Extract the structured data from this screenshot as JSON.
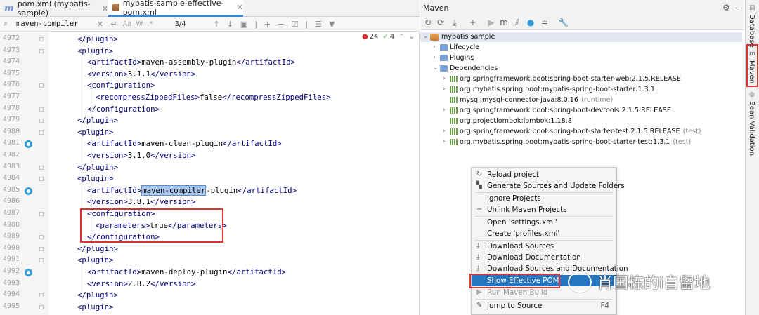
{
  "editor": {
    "tabs": [
      {
        "label": "pom.xml (mybatis-sample)"
      },
      {
        "label": "mybatis-sample-effective-pom.xml"
      }
    ],
    "find": {
      "query": "maven-compiler",
      "case_label": "Aa",
      "word_label": "W",
      "regex_label": ".*",
      "match_count": "3/4"
    },
    "inspections": {
      "warnings": "24",
      "ok": "4"
    },
    "lines": [
      {
        "num": "4972",
        "parts": [
          {
            "t": "tg",
            "v": "</plugin>"
          }
        ]
      },
      {
        "num": "4973",
        "parts": [
          {
            "t": "tg",
            "v": "<plugin>"
          }
        ]
      },
      {
        "num": "4974",
        "parts": [
          {
            "t": "tg",
            "v": "<artifactId>"
          },
          {
            "t": "tx",
            "v": "maven-assembly-plugin"
          },
          {
            "t": "tg",
            "v": "</artifactId>"
          }
        ]
      },
      {
        "num": "4975",
        "parts": [
          {
            "t": "tg",
            "v": "<version>"
          },
          {
            "t": "tx",
            "v": "3.1.1"
          },
          {
            "t": "tg",
            "v": "</version>"
          }
        ]
      },
      {
        "num": "4976",
        "parts": [
          {
            "t": "tg",
            "v": "<configuration>"
          }
        ]
      },
      {
        "num": "4977",
        "parts": [
          {
            "t": "tg",
            "v": "<recompressZippedFiles>"
          },
          {
            "t": "tx",
            "v": "false"
          },
          {
            "t": "tg",
            "v": "</recompressZippedFiles>"
          }
        ]
      },
      {
        "num": "4978",
        "parts": [
          {
            "t": "tg",
            "v": "</configuration>"
          }
        ]
      },
      {
        "num": "4979",
        "parts": [
          {
            "t": "tg",
            "v": "</plugin>"
          }
        ]
      },
      {
        "num": "4980",
        "parts": [
          {
            "t": "tg",
            "v": "<plugin>"
          }
        ]
      },
      {
        "num": "4981",
        "parts": [
          {
            "t": "tg",
            "v": "<artifactId>"
          },
          {
            "t": "tx",
            "v": "maven-clean-plugin"
          },
          {
            "t": "tg",
            "v": "</artifactId>"
          }
        ]
      },
      {
        "num": "4982",
        "parts": [
          {
            "t": "tg",
            "v": "<version>"
          },
          {
            "t": "tx",
            "v": "3.1.0"
          },
          {
            "t": "tg",
            "v": "</version>"
          }
        ]
      },
      {
        "num": "4983",
        "parts": [
          {
            "t": "tg",
            "v": "</plugin>"
          }
        ]
      },
      {
        "num": "4984",
        "parts": [
          {
            "t": "tg",
            "v": "<plugin>"
          }
        ]
      },
      {
        "num": "4985",
        "parts": [
          {
            "t": "tg",
            "v": "<artifactId>"
          },
          {
            "t": "hl",
            "v": "maven-compiler"
          },
          {
            "t": "tx",
            "v": "-plugin"
          },
          {
            "t": "tg",
            "v": "</artifactId>"
          }
        ]
      },
      {
        "num": "4986",
        "parts": [
          {
            "t": "tg",
            "v": "<version>"
          },
          {
            "t": "tx",
            "v": "3.8.1"
          },
          {
            "t": "tg",
            "v": "</version>"
          }
        ]
      },
      {
        "num": "4987",
        "parts": [
          {
            "t": "tg",
            "v": "<configuration>"
          }
        ]
      },
      {
        "num": "4988",
        "parts": [
          {
            "t": "tg",
            "v": "<parameters>"
          },
          {
            "t": "tx",
            "v": "true"
          },
          {
            "t": "tg",
            "v": "</parameters>"
          }
        ]
      },
      {
        "num": "4989",
        "parts": [
          {
            "t": "tg",
            "v": "</configuration>"
          }
        ]
      },
      {
        "num": "4990",
        "parts": [
          {
            "t": "tg",
            "v": "</plugin>"
          }
        ]
      },
      {
        "num": "4991",
        "parts": [
          {
            "t": "tg",
            "v": "<plugin>"
          }
        ]
      },
      {
        "num": "4992",
        "parts": [
          {
            "t": "tg",
            "v": "<artifactId>"
          },
          {
            "t": "tx",
            "v": "maven-deploy-plugin"
          },
          {
            "t": "tg",
            "v": "</artifactId>"
          }
        ]
      },
      {
        "num": "4993",
        "parts": [
          {
            "t": "tg",
            "v": "<version>"
          },
          {
            "t": "tx",
            "v": "2.8.2"
          },
          {
            "t": "tg",
            "v": "</version>"
          }
        ]
      },
      {
        "num": "4994",
        "parts": [
          {
            "t": "tg",
            "v": "</plugin>"
          }
        ]
      },
      {
        "num": "4995",
        "parts": [
          {
            "t": "tg",
            "v": "<plugin>"
          }
        ]
      }
    ]
  },
  "maven": {
    "title": "Maven",
    "tree": {
      "root": "mybatis sample",
      "lifecycle": "Lifecycle",
      "plugins": "Plugins",
      "dependencies": "Dependencies",
      "deps": [
        {
          "name": "org.springframework.boot:spring-boot-starter-web:2.1.5.RELEASE",
          "scope": ""
        },
        {
          "name": "org.mybatis.spring.boot:mybatis-spring-boot-starter:1.3.1",
          "scope": ""
        },
        {
          "name": "mysql:mysql-connector-java:8.0.16",
          "scope": "(runtime)"
        },
        {
          "name": "org.springframework.boot:spring-boot-devtools:2.1.5.RELEASE",
          "scope": ""
        },
        {
          "name": "org.projectlombok:lombok:1.18.8",
          "scope": ""
        },
        {
          "name": "org.springframework.boot:spring-boot-starter-test:2.1.5.RELEASE",
          "scope": "(test)"
        },
        {
          "name": "org.mybatis.spring.boot:mybatis-spring-boot-starter-test:1.3.1",
          "scope": "(test)"
        }
      ]
    },
    "context_menu": {
      "reload": "Reload project",
      "generate": "Generate Sources and Update Folders",
      "ignore": "Ignore Projects",
      "unlink": "Unlink Maven Projects",
      "open_settings": "Open 'settings.xml'",
      "create_profiles": "Create 'profiles.xml'",
      "download_sources": "Download Sources",
      "download_docs": "Download Documentation",
      "download_both": "Download Sources and Documentation",
      "show_effective": "Show Effective POM",
      "run_build": "Run Maven Build",
      "jump": "Jump to Source",
      "jump_shortcut": "F4"
    }
  },
  "side_strip": {
    "database": "Database",
    "maven": "Maven",
    "bean_validation": "Bean Validation"
  },
  "watermark": "肖国栋的i自留地"
}
